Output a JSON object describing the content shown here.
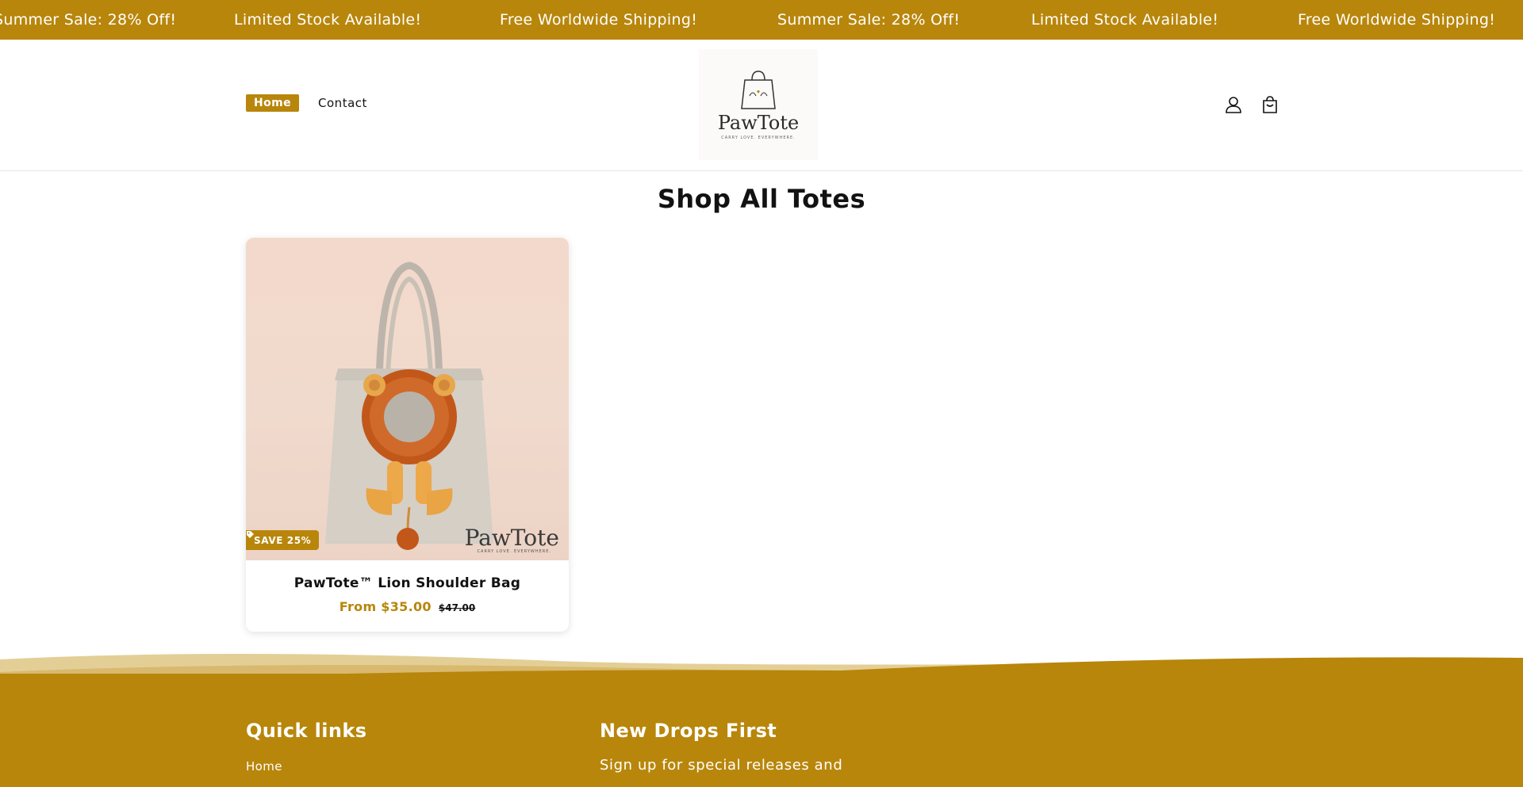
{
  "announcement": {
    "messages": [
      "Summer Sale: 28% Off!",
      "Limited Stock Available!",
      "Free Worldwide Shipping!",
      "Summer Sale: 28% Off!",
      "Limited Stock Available!",
      "Free Worldwide Shipping!"
    ]
  },
  "header": {
    "nav": {
      "home": "Home",
      "contact": "Contact"
    },
    "logo": {
      "name": "PawTote",
      "tagline": "CARRY LOVE. EVERYWHERE."
    },
    "icons": [
      "account-icon",
      "cart-icon"
    ]
  },
  "main": {
    "title": "Shop All Totes",
    "products": [
      {
        "title": "PawTote™ Lion Shoulder Bag",
        "badge": "SAVE 25%",
        "price": "From $35.00",
        "compare_price": "$47.00",
        "image_watermark": "PawTote",
        "image_watermark_tag": "CARRY LOVE. EVERYWHERE."
      }
    ]
  },
  "footer": {
    "quick_links": {
      "heading": "Quick links",
      "items": [
        "Home"
      ]
    },
    "newsletter": {
      "heading": "New Drops First",
      "text": "Sign up for special releases and"
    }
  },
  "colors": {
    "brand": "#b8860b",
    "text": "#121212",
    "background": "#ffffff"
  }
}
